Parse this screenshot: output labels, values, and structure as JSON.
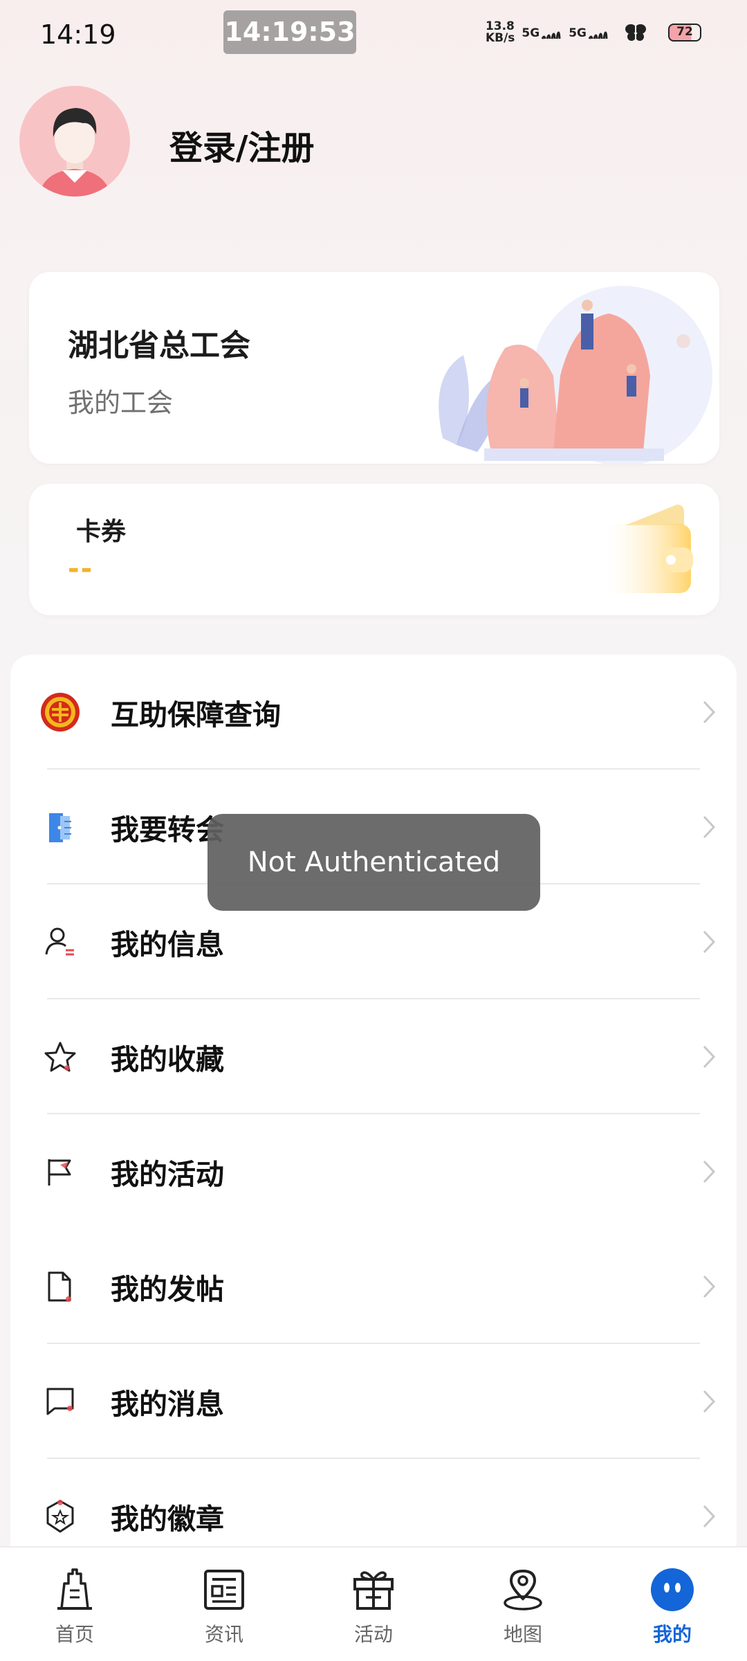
{
  "status_bar": {
    "time": "14:19",
    "clock_pill": "14:19:53",
    "net_speed_value": "13.8",
    "net_speed_unit": "KB/s",
    "sim1": "5G",
    "sim2": "5G",
    "battery": "72"
  },
  "profile": {
    "login_label": "登录/注册"
  },
  "union_card": {
    "name": "湖北省总工会",
    "subtitle": "我的工会"
  },
  "coupon_card": {
    "title": "卡券",
    "value": "--"
  },
  "menu": [
    {
      "label": "互助保障查询",
      "icon": "union-emblem-icon"
    },
    {
      "label": "我要转会",
      "icon": "door-icon"
    },
    {
      "label": "我的信息",
      "icon": "person-icon"
    },
    {
      "label": "我的收藏",
      "icon": "star-icon"
    },
    {
      "label": "我的活动",
      "icon": "flag-icon"
    },
    {
      "label": "我的发帖",
      "icon": "document-icon"
    },
    {
      "label": "我的消息",
      "icon": "message-icon"
    },
    {
      "label": "我的徽章",
      "icon": "badge-icon"
    }
  ],
  "toast": {
    "message": "Not Authenticated"
  },
  "bottom_nav": [
    {
      "label": "首页",
      "icon": "home-tower-icon",
      "active": false
    },
    {
      "label": "资讯",
      "icon": "news-icon",
      "active": false
    },
    {
      "label": "活动",
      "icon": "gift-icon",
      "active": false
    },
    {
      "label": "地图",
      "icon": "map-pin-icon",
      "active": false
    },
    {
      "label": "我的",
      "icon": "profile-face-icon",
      "active": true
    }
  ],
  "colors": {
    "accent": "#1465d7",
    "coupon_value": "#f3b12a",
    "avatar_bg": "#f8c3c5"
  }
}
